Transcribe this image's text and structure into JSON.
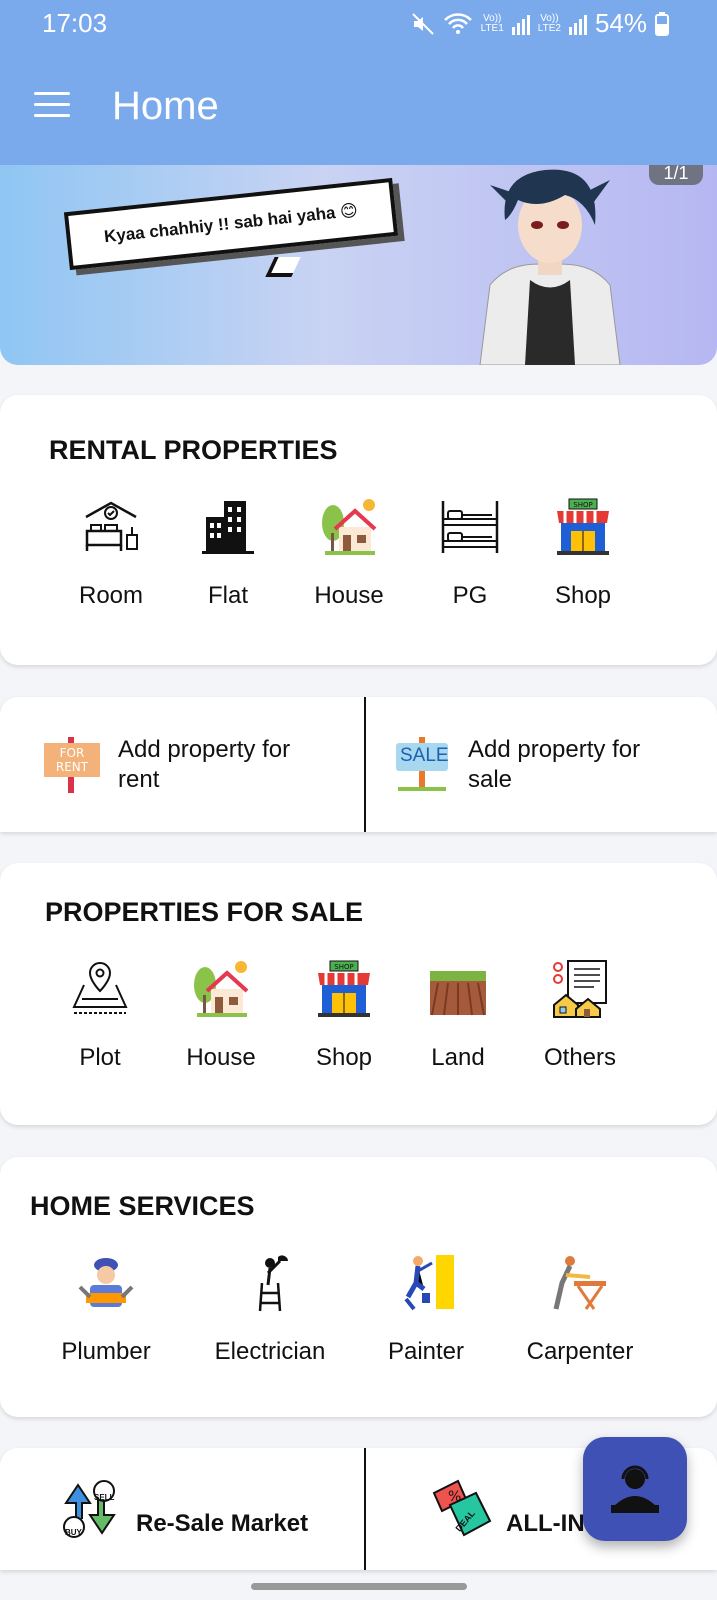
{
  "status_bar": {
    "time": "17:03",
    "net1": "Vo))\nLTE1",
    "net2": "Vo))\nLTE2",
    "battery": "54%"
  },
  "app_bar": {
    "title": "Home",
    "menu_icon": "hamburger-menu-icon"
  },
  "banner": {
    "counter": "1/1",
    "speech": "Kyaa chahhiy !! sab hai yaha 😊"
  },
  "rental": {
    "heading": "RENTAL PROPERTIES",
    "items": [
      {
        "label": "Room",
        "icon": "bed-room-icon"
      },
      {
        "label": "Flat",
        "icon": "building-icon"
      },
      {
        "label": "House",
        "icon": "house-icon"
      },
      {
        "label": "PG",
        "icon": "bunk-bed-icon"
      },
      {
        "label": "Shop",
        "icon": "shop-icon"
      }
    ]
  },
  "add_property": {
    "rent_sign": "FOR\nRENT",
    "rent_label": "Add property for rent",
    "sale_sign": "SALE",
    "sale_label": "Add property for sale"
  },
  "sale": {
    "heading": "PROPERTIES FOR SALE",
    "items": [
      {
        "label": "Plot",
        "icon": "plot-pin-icon"
      },
      {
        "label": "House",
        "icon": "house-icon"
      },
      {
        "label": "Shop",
        "icon": "shop-icon"
      },
      {
        "label": "Land",
        "icon": "land-icon"
      },
      {
        "label": "Others",
        "icon": "documents-houses-icon"
      }
    ]
  },
  "services": {
    "heading": "HOME SERVICES",
    "items": [
      {
        "label": "Plumber",
        "icon": "plumber-icon"
      },
      {
        "label": "Electrician",
        "icon": "electrician-icon"
      },
      {
        "label": "Painter",
        "icon": "painter-icon"
      },
      {
        "label": "Carpenter",
        "icon": "carpenter-icon"
      }
    ]
  },
  "bottom": {
    "resale_label": "Re-Sale Market",
    "sell_tag": "SELL",
    "buy_tag": "BUY",
    "allin_label": "ALL-IN",
    "deal_tag": "DEAL"
  },
  "colors": {
    "app_bar": "#7aa9ec",
    "fab": "#3f51b5"
  }
}
